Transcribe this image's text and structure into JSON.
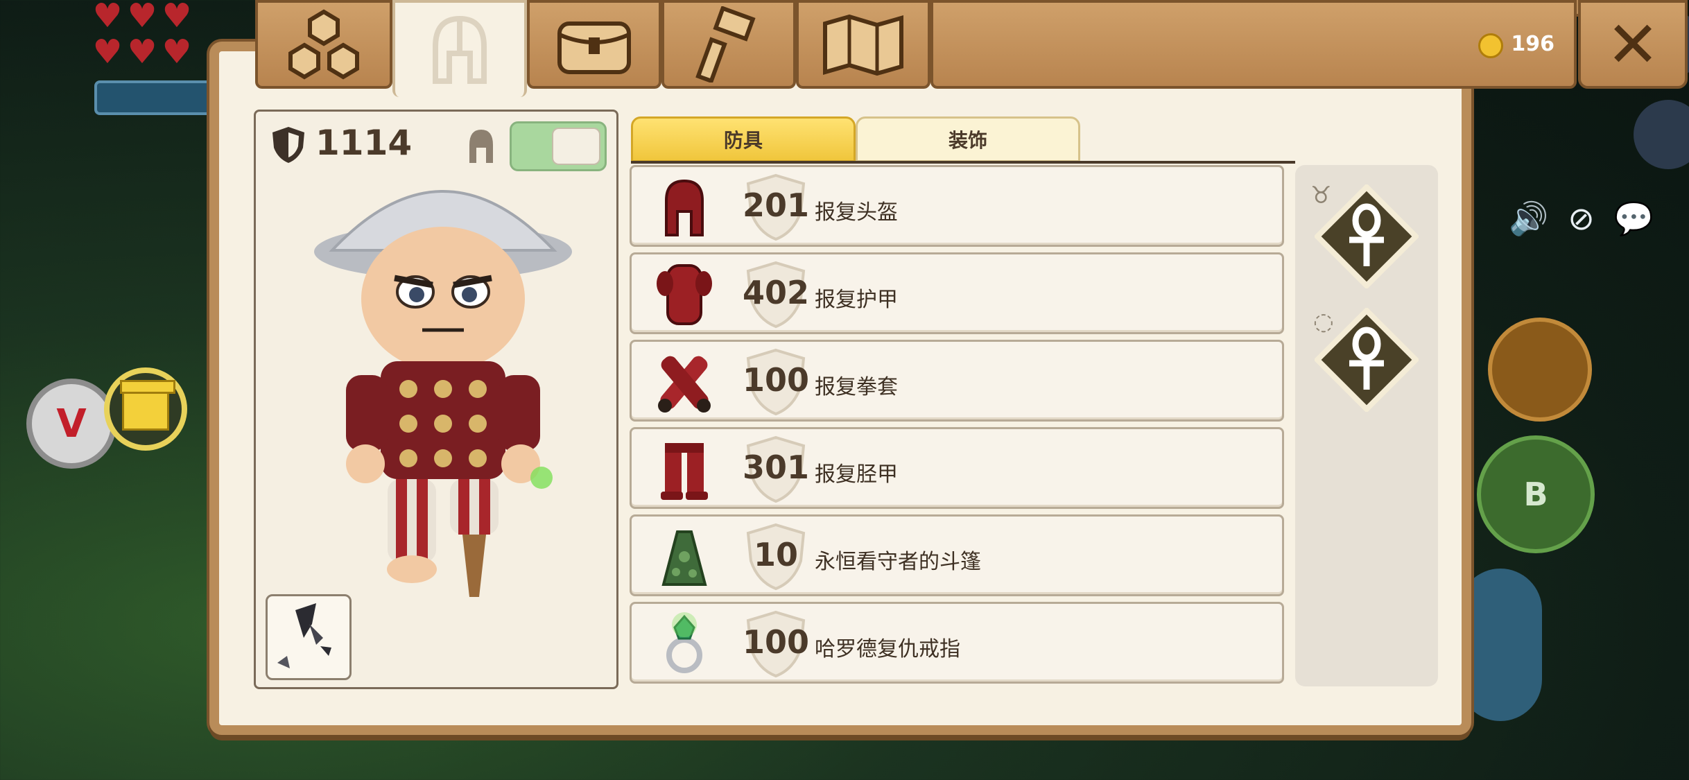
{
  "hud": {
    "b_button": "B",
    "v_button": "V"
  },
  "tabs": [
    {
      "name": "tab-crafting",
      "icon": "nodes-icon"
    },
    {
      "name": "tab-equipment",
      "icon": "helmet-icon",
      "active": true
    },
    {
      "name": "tab-backpack",
      "icon": "backpack-icon"
    },
    {
      "name": "tab-build",
      "icon": "hammer-icon"
    },
    {
      "name": "tab-map",
      "icon": "map-icon"
    }
  ],
  "currency": {
    "icon": "coin-icon",
    "value": "196"
  },
  "close_icon": "close-icon",
  "character": {
    "defense_total": "1114",
    "helmet_visible_toggle": true
  },
  "subtabs": {
    "armor": "防具",
    "accessories": "装饰"
  },
  "equipment": [
    {
      "armor": "201",
      "name": "报复头盔",
      "icon": "helmet-item-icon"
    },
    {
      "armor": "402",
      "name": "报复护甲",
      "icon": "chestplate-item-icon"
    },
    {
      "armor": "100",
      "name": "报复拳套",
      "icon": "gauntlets-item-icon"
    },
    {
      "armor": "301",
      "name": "报复胫甲",
      "icon": "greaves-item-icon"
    },
    {
      "armor": "10",
      "name": "永恒看守者的斗篷",
      "icon": "cloak-item-icon"
    },
    {
      "armor": "100",
      "name": "哈罗德复仇戒指",
      "icon": "ring-item-icon"
    }
  ],
  "colors": {
    "panel_bg": "#f7f1e3",
    "wood": "#b98c59",
    "active_subtab": "#f0c63c",
    "toggle_on": "#a9d79e"
  }
}
